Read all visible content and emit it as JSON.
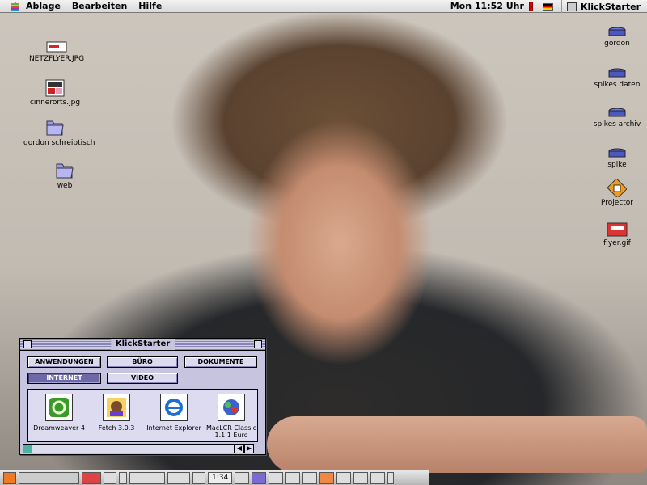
{
  "menubar": {
    "apple_icon": "apple-icon",
    "items": [
      "Ablage",
      "Bearbeiten",
      "Hilfe"
    ],
    "clock": "Mon 11:52 Uhr",
    "app_name": "KlickStarter"
  },
  "desktop_icons_left": [
    {
      "label": "NETZFLYER.JPG",
      "icon": "image-file-icon"
    },
    {
      "label": "cinnerorts.jpg",
      "icon": "image-file-icon"
    },
    {
      "label": "gordon schreibtisch",
      "icon": "folder-icon"
    },
    {
      "label": "web",
      "icon": "folder-icon"
    }
  ],
  "desktop_icons_right": [
    {
      "label": "gordon",
      "icon": "network-volume-icon"
    },
    {
      "label": "spikes daten",
      "icon": "network-volume-icon"
    },
    {
      "label": "spikes archiv",
      "icon": "network-volume-icon"
    },
    {
      "label": "spike",
      "icon": "network-volume-icon"
    },
    {
      "label": "Projector",
      "icon": "projector-app-icon"
    },
    {
      "label": "flyer.gif",
      "icon": "image-file-icon"
    }
  ],
  "klickstarter": {
    "title": "KlickStarter",
    "tabs": [
      {
        "label": "ANWENDUNGEN",
        "active": false
      },
      {
        "label": "BÜRO",
        "active": false
      },
      {
        "label": "DOKUMENTE",
        "active": false
      },
      {
        "label": "INTERNET",
        "active": true
      },
      {
        "label": "VIDEO",
        "active": false
      }
    ],
    "apps": [
      {
        "label": "Dreamweaver 4",
        "icon": "dreamweaver-icon"
      },
      {
        "label": "Fetch 3.0.3",
        "icon": "fetch-dog-icon"
      },
      {
        "label": "Internet Explorer",
        "icon": "internet-explorer-icon"
      },
      {
        "label": "MacLCR Classic 1.1.1 Euro",
        "icon": "maclcr-globe-icon"
      }
    ]
  },
  "control_strip": {
    "time": "1:34"
  },
  "colors": {
    "window_bg": "#c7c4e0",
    "active_tab": "#6d69a6",
    "menubar": "#e6e6e6"
  }
}
